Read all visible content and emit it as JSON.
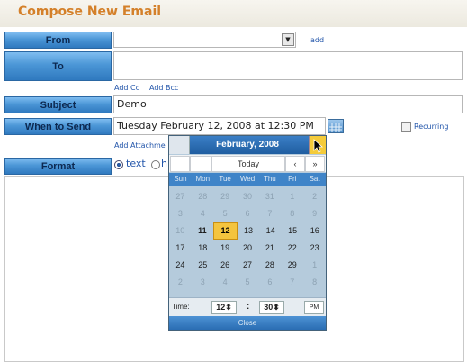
{
  "header": {
    "title": "Compose New Email"
  },
  "form": {
    "from_label": "From",
    "from_value": "",
    "from_add": "add",
    "to_label": "To",
    "to_value": "",
    "add_cc": "Add Cc",
    "add_bcc": "Add Bcc",
    "subject_label": "Subject",
    "subject_value": "Demo",
    "when_label": "When to Send",
    "when_value": "Tuesday February 12, 2008 at 12:30 PM",
    "recurring_label": "Recurring",
    "add_attachment": "Add Attachme",
    "format_label": "Format",
    "format_text": "text",
    "format_html": "h"
  },
  "calendar": {
    "month_label": "February, 2008",
    "today_label": "Today",
    "prev_month": "‹",
    "next_month": "»",
    "weekdays": [
      "Sun",
      "Mon",
      "Tue",
      "Wed",
      "Thu",
      "Fri",
      "Sat"
    ],
    "weeks": [
      [
        "27",
        "28",
        "29",
        "30",
        "31",
        "1",
        "2"
      ],
      [
        "3",
        "4",
        "5",
        "6",
        "7",
        "8",
        "9"
      ],
      [
        "10",
        "11",
        "12",
        "13",
        "14",
        "15",
        "16"
      ],
      [
        "17",
        "18",
        "19",
        "20",
        "21",
        "22",
        "23"
      ],
      [
        "24",
        "25",
        "26",
        "27",
        "28",
        "29",
        "1"
      ],
      [
        "2",
        "3",
        "4",
        "5",
        "6",
        "7",
        "8"
      ]
    ],
    "time_label": "Time:",
    "hour": "12",
    "sep": ":",
    "minute": "30",
    "ampm": "PM",
    "close_label": "Close"
  },
  "colors": {
    "accent": "#d4802a",
    "label_blue": "#4b96d6",
    "selected": "#f4c43e"
  }
}
